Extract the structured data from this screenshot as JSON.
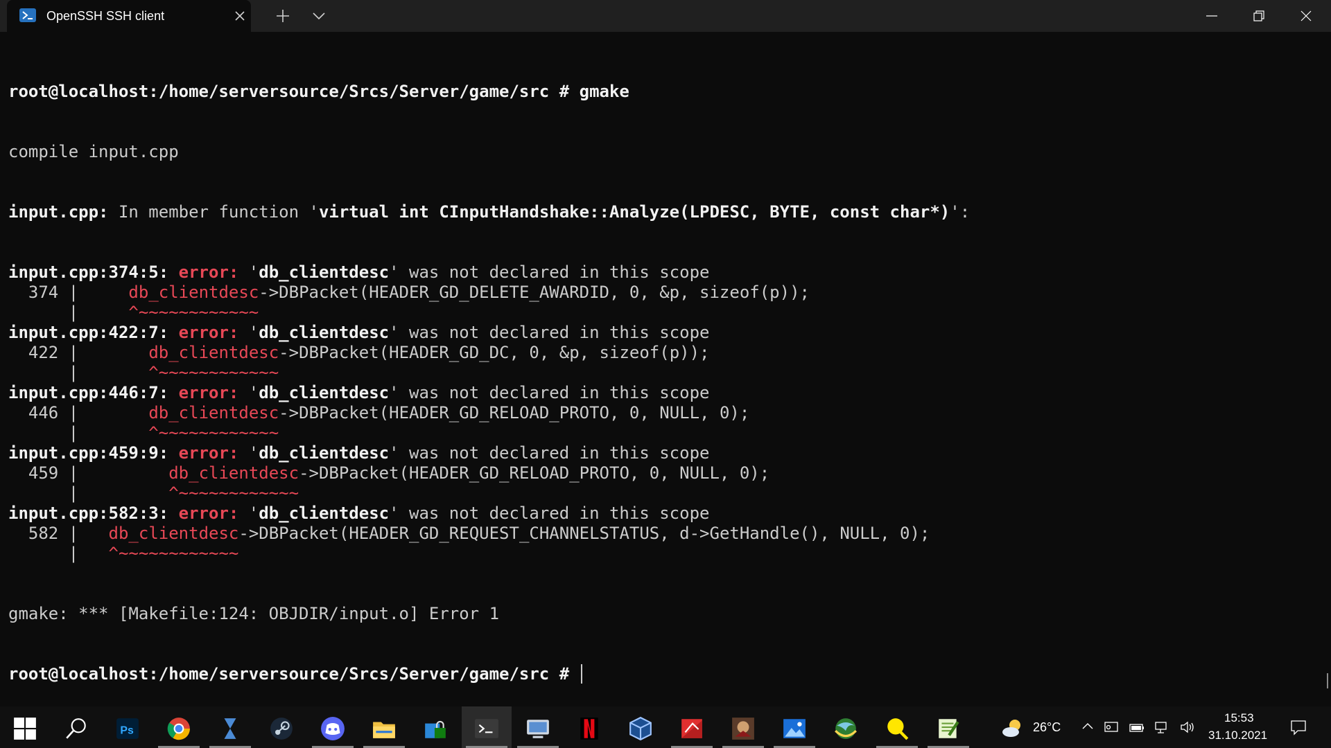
{
  "window": {
    "tab_title": "OpenSSH SSH client",
    "tab_icon": "powershell-icon",
    "new_tab_icon": "plus-icon",
    "dropdown_icon": "chevron-down-icon",
    "controls": [
      "minimize-icon",
      "restore-icon",
      "close-icon"
    ]
  },
  "terminal": {
    "prompt_dir": "root@localhost:/home/serversource/Srcs/Server/game/src",
    "command": "gmake",
    "compile_line": "compile input.cpp",
    "context_file": "input.cpp:",
    "context_mid": " In member function '",
    "context_func": "virtual int CInputHandshake::Analyze(LPDESC, BYTE, const char*)",
    "context_end": "':",
    "errors": [
      {
        "loc": "input.cpp:374:5:",
        "label": "error:",
        "msg_q1": "'",
        "ident": "db_clientdesc",
        "msg_q2": "' was not declared in this scope",
        "lineno": "374",
        "indent": "    ",
        "code": "->DBPacket(HEADER_GD_DELETE_AWARDID, 0, &p, sizeof(p));",
        "marker": "^~~~~~~~~~~~~"
      },
      {
        "loc": "input.cpp:422:7:",
        "label": "error:",
        "msg_q1": "'",
        "ident": "db_clientdesc",
        "msg_q2": "' was not declared in this scope",
        "lineno": "422",
        "indent": "      ",
        "code": "->DBPacket(HEADER_GD_DC, 0, &p, sizeof(p));",
        "marker": "^~~~~~~~~~~~~"
      },
      {
        "loc": "input.cpp:446:7:",
        "label": "error:",
        "msg_q1": "'",
        "ident": "db_clientdesc",
        "msg_q2": "' was not declared in this scope",
        "lineno": "446",
        "indent": "      ",
        "code": "->DBPacket(HEADER_GD_RELOAD_PROTO, 0, NULL, 0);",
        "marker": "^~~~~~~~~~~~~"
      },
      {
        "loc": "input.cpp:459:9:",
        "label": "error:",
        "msg_q1": "'",
        "ident": "db_clientdesc",
        "msg_q2": "' was not declared in this scope",
        "lineno": "459",
        "indent": "        ",
        "code": "->DBPacket(HEADER_GD_RELOAD_PROTO, 0, NULL, 0);",
        "marker": "^~~~~~~~~~~~~"
      },
      {
        "loc": "input.cpp:582:3:",
        "label": "error:",
        "msg_q1": "'",
        "ident": "db_clientdesc",
        "msg_q2": "' was not declared in this scope",
        "lineno": "582",
        "indent": "  ",
        "code": "->DBPacket(HEADER_GD_REQUEST_CHANNELSTATUS, d->GetHandle(), NULL, 0);",
        "marker": "^~~~~~~~~~~~~"
      }
    ],
    "gmake_error": "gmake: *** [Makefile:124: OBJDIR/input.o] Error 1",
    "final_prompt": "root@localhost:/home/serversource/Srcs/Server/game/src # "
  },
  "taskbar": {
    "apps": [
      {
        "name": "start-icon"
      },
      {
        "name": "search-icon"
      },
      {
        "name": "photoshop-icon"
      },
      {
        "name": "chrome-icon"
      },
      {
        "name": "hourglass-app-icon"
      },
      {
        "name": "steam-icon"
      },
      {
        "name": "discord-icon"
      },
      {
        "name": "file-explorer-icon"
      },
      {
        "name": "secure-folder-icon"
      },
      {
        "name": "terminal-icon"
      },
      {
        "name": "remote-desktop-icon"
      },
      {
        "name": "netflix-icon"
      },
      {
        "name": "virtualbox-icon"
      },
      {
        "name": "pdf-reader-icon"
      },
      {
        "name": "game-icon"
      },
      {
        "name": "photos-icon"
      },
      {
        "name": "browser-globe-icon"
      },
      {
        "name": "magnifier-icon"
      },
      {
        "name": "notepad-plus-icon"
      }
    ],
    "weather": {
      "icon": "partly-cloudy-icon",
      "temp": "26°C"
    },
    "tray_icons": [
      "chevron-up-icon",
      "network-drive-icon",
      "battery-icon",
      "wired-network-icon",
      "volume-icon"
    ],
    "time": "15:53",
    "date": "31.10.2021",
    "notifications_icon": "action-center-icon"
  },
  "colors": {
    "terminal_bg": "#0c0c0c",
    "terminal_fg": "#cccccc",
    "error_red": "#e74856",
    "titlebar_bg": "#202020",
    "taskbar_bg": "#101010"
  }
}
